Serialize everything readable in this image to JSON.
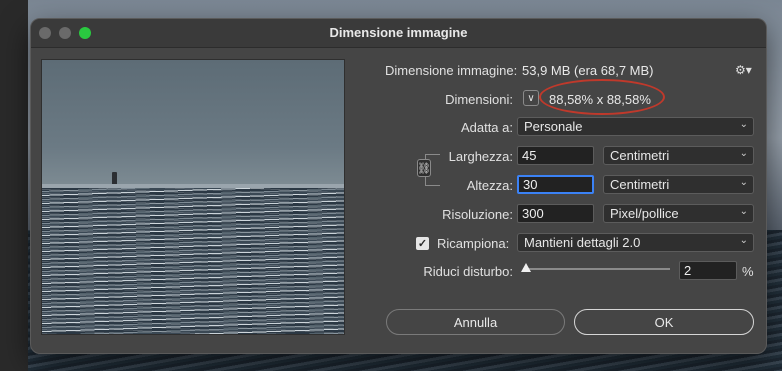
{
  "window": {
    "title": "Dimensione immagine"
  },
  "info": {
    "size_label": "Dimensione immagine:",
    "size_value": "53,9 MB (era 68,7 MB)",
    "dimensions_label": "Dimensioni:",
    "dimensions_value": "88,58% x 88,58%"
  },
  "fit": {
    "label": "Adatta a:",
    "selected": "Personale"
  },
  "width": {
    "label": "Larghezza:",
    "value": "45",
    "unit": "Centimetri"
  },
  "height": {
    "label": "Altezza:",
    "value": "30",
    "unit": "Centimetri"
  },
  "resolution": {
    "label": "Risoluzione:",
    "value": "300",
    "unit": "Pixel/pollice"
  },
  "resample": {
    "label": "Ricampiona:",
    "checked": true,
    "method": "Mantieni dettagli 2.0"
  },
  "noise": {
    "label": "Riduci disturbo:",
    "value": "2",
    "unit": "%",
    "slider_fraction": 0.02
  },
  "buttons": {
    "cancel": "Annulla",
    "ok": "OK"
  },
  "colors": {
    "dialog_bg": "#454545",
    "annotation_circle": "#c0392b",
    "focus_ring": "#3b82f6",
    "zoom_button": "#2ac940"
  },
  "icons": {
    "gear": "gear-icon",
    "link": "chain-link-icon",
    "dimensions_toggle": "chevron-down-icon"
  }
}
